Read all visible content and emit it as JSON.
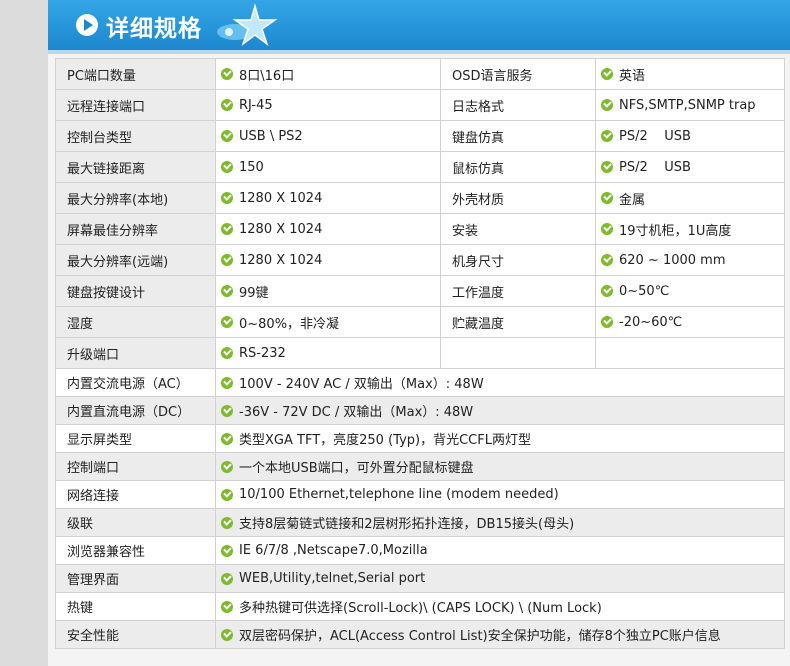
{
  "header": {
    "title": "详细规格"
  },
  "colors": {
    "header_blue": "#1c87cf",
    "check_green": "#7cbb2a"
  },
  "specs_left": [
    {
      "label": "PC端口数量",
      "value": "8口\\16口"
    },
    {
      "label": "远程连接端口",
      "value": "RJ-45"
    },
    {
      "label": "控制台类型",
      "value": "USB \\ PS2"
    },
    {
      "label": "最大链接距离",
      "value": "150"
    },
    {
      "label": "最大分辨率(本地)",
      "value": "1280 X 1024"
    },
    {
      "label": "屏幕最佳分辨率",
      "value": "1280 X 1024"
    },
    {
      "label": "最大分辨率(远端)",
      "value": "1280 X 1024"
    },
    {
      "label": "键盘按键设计",
      "value": "99键"
    },
    {
      "label": "湿度",
      "value": "0~80%，非冷凝"
    },
    {
      "label": "升级端口",
      "value": "RS-232"
    }
  ],
  "specs_right": [
    {
      "label": "OSD语言服务",
      "value": "英语"
    },
    {
      "label": "日志格式",
      "value": "NFS,SMTP,SNMP trap"
    },
    {
      "label": "键盘仿真",
      "value": "PS/2    USB"
    },
    {
      "label": "鼠标仿真",
      "value": "PS/2    USB"
    },
    {
      "label": "外壳材质",
      "value": "金属"
    },
    {
      "label": "安装",
      "value": "19寸机柜，1U高度"
    },
    {
      "label": "机身尺寸",
      "value": "620 ~ 1000 mm"
    },
    {
      "label": "工作温度",
      "value": "0~50℃"
    },
    {
      "label": "贮藏温度",
      "value": "-20~60℃"
    },
    {
      "label": "",
      "value": ""
    }
  ],
  "specs_full": [
    {
      "label": "内置交流电源（AC）",
      "value": "100V - 240V AC / 双输出（Max）: 48W"
    },
    {
      "label": "内置直流电源（DC）",
      "value": "-36V - 72V DC / 双输出（Max）: 48W"
    },
    {
      "label": "显示屏类型",
      "value": "类型XGA TFT，亮度250 (Typ)，背光CCFL两灯型"
    },
    {
      "label": "控制端口",
      "value": "一个本地USB端口，可外置分配鼠标键盘"
    },
    {
      "label": "网络连接",
      "value": "10/100 Ethernet,telephone line (modem needed)"
    },
    {
      "label": "级联",
      "value": "支持8层菊链式链接和2层树形拓扑连接，DB15接头(母头)"
    },
    {
      "label": "浏览器兼容性",
      "value": "IE 6/7/8 ,Netscape7.0,Mozilla"
    },
    {
      "label": "管理界面",
      "value": "WEB,Utility,telnet,Serial port"
    },
    {
      "label": "热键",
      "value": "多种热键可供选择(Scroll-Lock)\\ (CAPS LOCK) \\ (Num Lock)"
    },
    {
      "label": "安全性能",
      "value": "双层密码保护，ACL(Access Control List)安全保护功能，储存8个独立PC账户信息"
    }
  ]
}
